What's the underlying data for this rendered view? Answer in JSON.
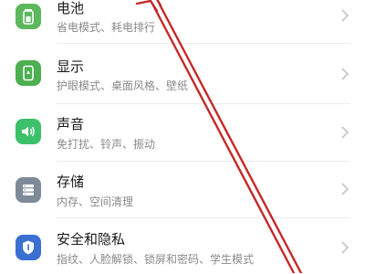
{
  "settings": {
    "items": [
      {
        "title": "电池",
        "subtitle": "省电模式、耗电排行",
        "icon": "battery-icon",
        "color": "#5cb85c"
      },
      {
        "title": "显示",
        "subtitle": "护眼模式、桌面风格、壁纸",
        "icon": "display-icon",
        "color": "#4caf50"
      },
      {
        "title": "声音",
        "subtitle": "免打扰、铃声、振动",
        "icon": "sound-icon",
        "color": "#3cc16a"
      },
      {
        "title": "存储",
        "subtitle": "内存、空间清理",
        "icon": "storage-icon",
        "color": "#7f8a99"
      },
      {
        "title": "安全和隐私",
        "subtitle": "指纹、人脸解锁、锁屏和密码、学生模式",
        "icon": "security-icon",
        "color": "#3b6fd1"
      }
    ]
  },
  "annotation": {
    "arrow_color": "#c62828"
  }
}
